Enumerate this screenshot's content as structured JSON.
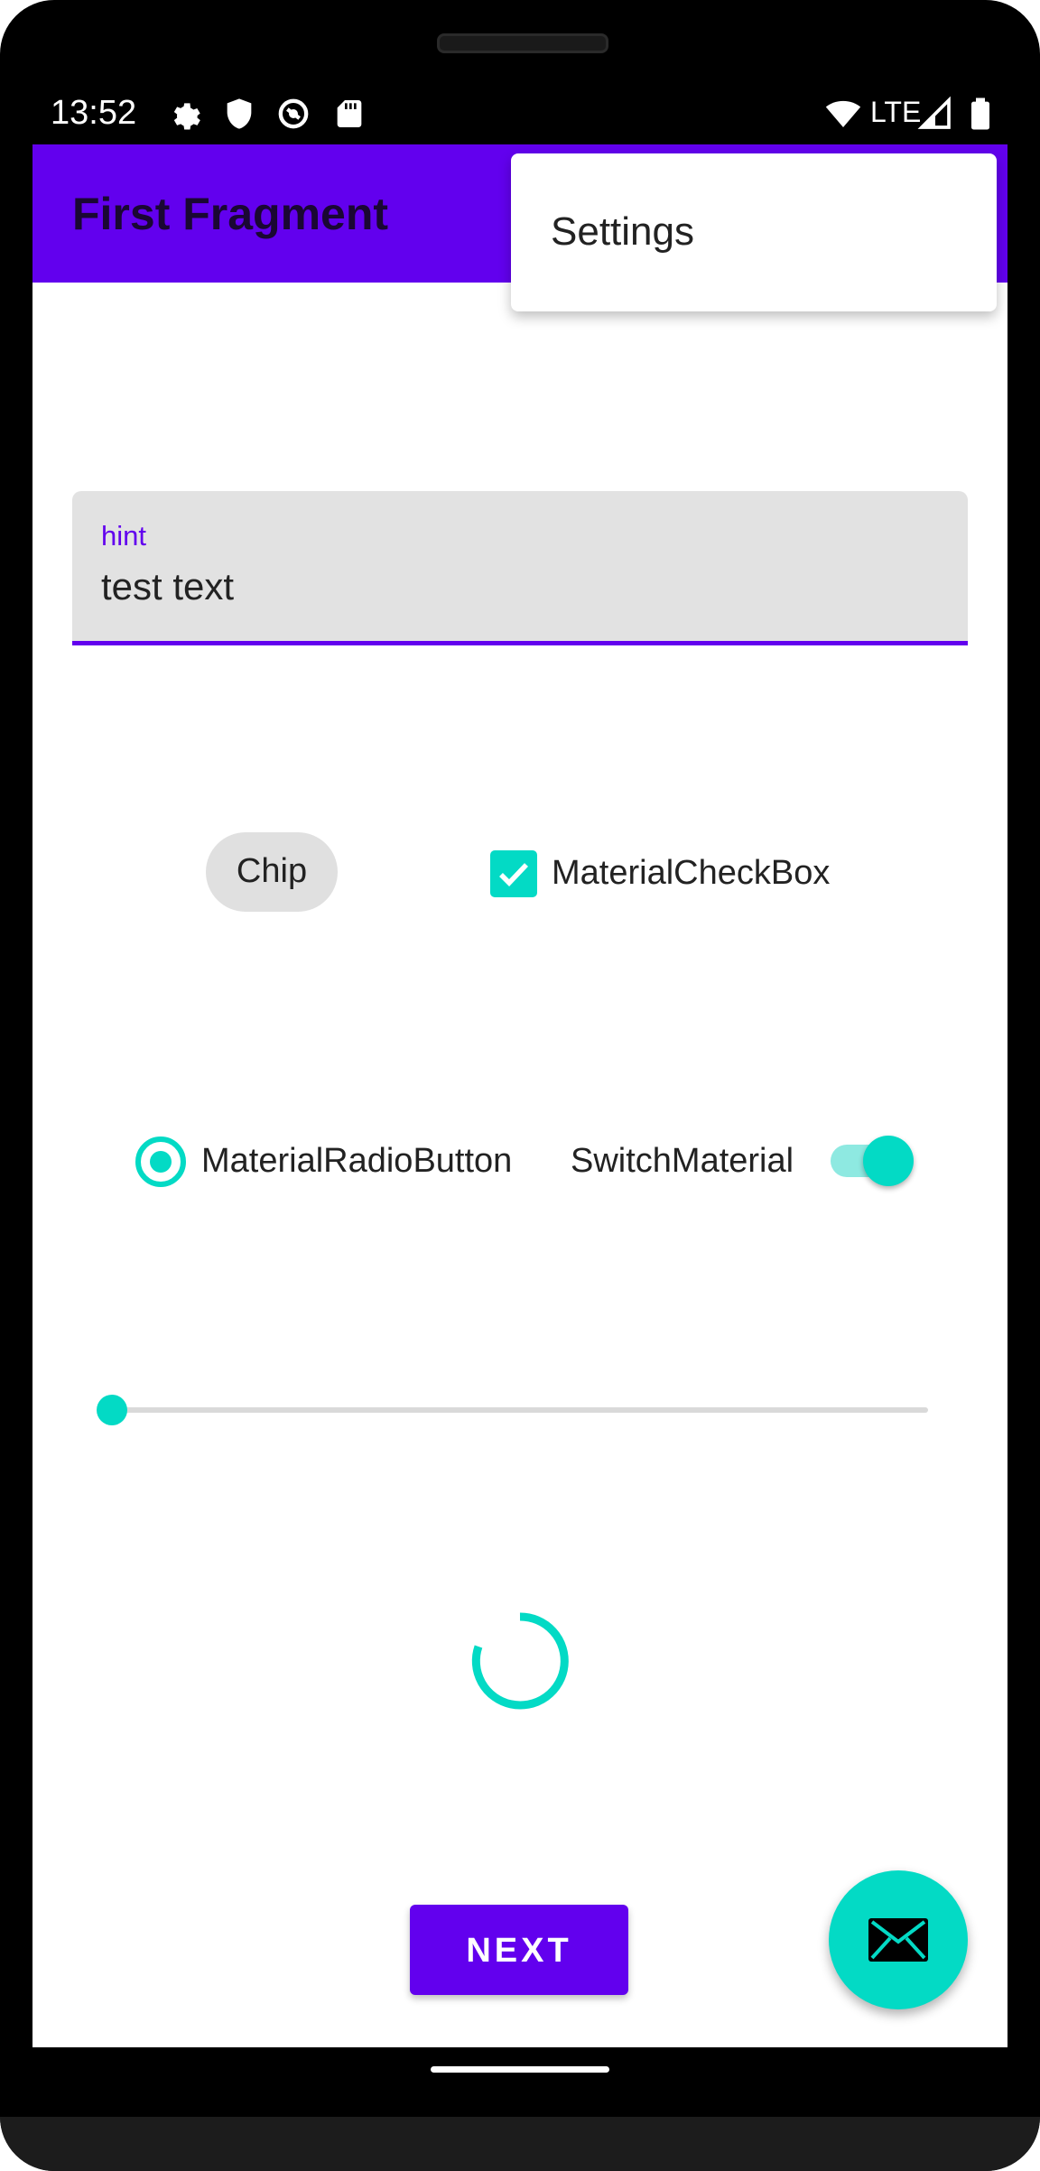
{
  "status_bar": {
    "time": "13:52",
    "network": "LTE",
    "icons": [
      "gear-icon",
      "shield-icon",
      "sync-icon",
      "sd-card-icon",
      "wifi-icon",
      "cell-signal-icon",
      "battery-icon"
    ]
  },
  "app_bar": {
    "title": "First Fragment",
    "color": "#6200ee"
  },
  "overflow_menu": {
    "items": [
      {
        "label": "Settings"
      }
    ]
  },
  "text_field": {
    "hint": "hint",
    "value": "test text"
  },
  "chip": {
    "label": "Chip"
  },
  "checkbox": {
    "label": "MaterialCheckBox",
    "checked": true
  },
  "radio": {
    "label": "MaterialRadioButton",
    "selected": true
  },
  "switch": {
    "label": "SwitchMaterial",
    "on": true
  },
  "slider": {
    "value": 0,
    "min": 0,
    "max": 100
  },
  "progress": {
    "type": "indeterminate-circular"
  },
  "next_button": {
    "label": "NEXT"
  },
  "fab": {
    "icon": "mail-icon"
  },
  "colors": {
    "primary": "#6200ee",
    "secondary": "#03dac5"
  }
}
